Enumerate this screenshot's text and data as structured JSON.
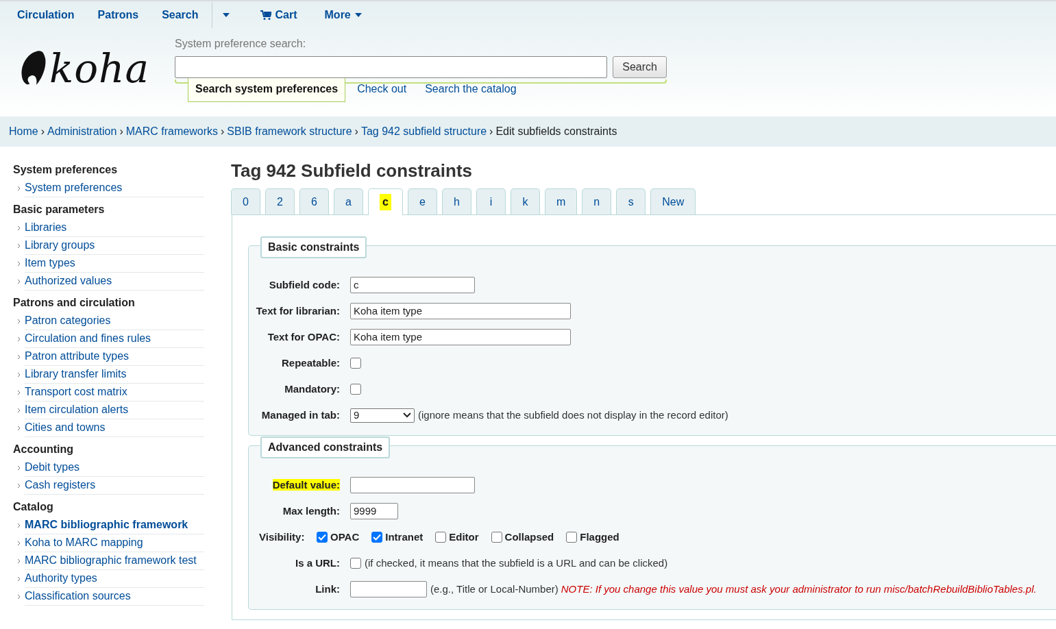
{
  "navbar": {
    "items": [
      {
        "kind": "link",
        "label": "Circulation"
      },
      {
        "kind": "link",
        "label": "Patrons"
      },
      {
        "kind": "link",
        "label": "Search"
      },
      {
        "kind": "caret"
      },
      {
        "kind": "cart",
        "label": "Cart"
      },
      {
        "kind": "menu",
        "label": "More"
      }
    ]
  },
  "logo": {
    "text": "koha"
  },
  "syspref_search": {
    "label": "System preference search:",
    "button": "Search",
    "tabs": [
      {
        "label": "Search system preferences",
        "selected": true
      },
      {
        "label": "Check out",
        "selected": false
      },
      {
        "label": "Search the catalog",
        "selected": false
      }
    ]
  },
  "breadcrumb": {
    "separator": "›",
    "items": [
      {
        "label": "Home",
        "link": true
      },
      {
        "label": "Administration",
        "link": true
      },
      {
        "label": "MARC frameworks",
        "link": true
      },
      {
        "label": "SBIB framework structure",
        "link": true
      },
      {
        "label": "Tag 942 subfield structure",
        "link": true
      },
      {
        "label": "Edit subfields constraints",
        "link": false
      }
    ]
  },
  "sidebar": {
    "sections": [
      {
        "heading": "System preferences",
        "items": [
          {
            "label": "System preferences",
            "selected": false
          }
        ]
      },
      {
        "heading": "Basic parameters",
        "items": [
          {
            "label": "Libraries",
            "selected": false
          },
          {
            "label": "Library groups",
            "selected": false
          },
          {
            "label": "Item types",
            "selected": false
          },
          {
            "label": "Authorized values",
            "selected": false
          }
        ]
      },
      {
        "heading": "Patrons and circulation",
        "items": [
          {
            "label": "Patron categories",
            "selected": false
          },
          {
            "label": "Circulation and fines rules",
            "selected": false
          },
          {
            "label": "Patron attribute types",
            "selected": false
          },
          {
            "label": "Library transfer limits",
            "selected": false
          },
          {
            "label": "Transport cost matrix",
            "selected": false
          },
          {
            "label": "Item circulation alerts",
            "selected": false
          },
          {
            "label": "Cities and towns",
            "selected": false
          }
        ]
      },
      {
        "heading": "Accounting",
        "items": [
          {
            "label": "Debit types",
            "selected": false
          },
          {
            "label": "Cash registers",
            "selected": false
          }
        ]
      },
      {
        "heading": "Catalog",
        "items": [
          {
            "label": "MARC bibliographic framework",
            "selected": true
          },
          {
            "label": "Koha to MARC mapping",
            "selected": false
          },
          {
            "label": "MARC bibliographic framework test",
            "selected": false
          },
          {
            "label": "Authority types",
            "selected": false
          },
          {
            "label": "Classification sources",
            "selected": false
          }
        ]
      }
    ]
  },
  "main": {
    "title": "Tag 942 Subfield constraints",
    "tabs": [
      {
        "label": "0",
        "selected": false,
        "highlighted": false
      },
      {
        "label": "2",
        "selected": false,
        "highlighted": false
      },
      {
        "label": "6",
        "selected": false,
        "highlighted": false
      },
      {
        "label": "a",
        "selected": false,
        "highlighted": false
      },
      {
        "label": "c",
        "selected": true,
        "highlighted": true
      },
      {
        "label": "e",
        "selected": false,
        "highlighted": false
      },
      {
        "label": "h",
        "selected": false,
        "highlighted": false
      },
      {
        "label": "i",
        "selected": false,
        "highlighted": false
      },
      {
        "label": "k",
        "selected": false,
        "highlighted": false
      },
      {
        "label": "m",
        "selected": false,
        "highlighted": false
      },
      {
        "label": "n",
        "selected": false,
        "highlighted": false
      },
      {
        "label": "s",
        "selected": false,
        "highlighted": false
      },
      {
        "label": "New",
        "selected": false,
        "highlighted": false
      }
    ],
    "fieldsets": [
      {
        "legend": "Basic constraints",
        "rows": [
          {
            "kind": "input",
            "label": "Subfield code:",
            "value": "c",
            "highlighted": false
          },
          {
            "kind": "wideinput",
            "label": "Text for librarian:",
            "value": "Koha item type",
            "highlighted": false
          },
          {
            "kind": "wideinput",
            "label": "Text for OPAC:",
            "value": "Koha item type",
            "highlighted": false
          },
          {
            "kind": "checkbox",
            "label": "Repeatable:",
            "checked": false
          },
          {
            "kind": "checkbox",
            "label": "Mandatory:",
            "checked": false
          },
          {
            "kind": "select",
            "label": "Managed in tab:",
            "value": "9",
            "note": "(ignore means that the subfield does not display in the record editor)"
          }
        ]
      },
      {
        "legend": "Advanced constraints",
        "rows": [
          {
            "kind": "input",
            "label": "Default value:",
            "highlighted": true
          },
          {
            "kind": "numinput",
            "label": "Max length:",
            "value": "9999",
            "highlighted": false
          },
          {
            "kind": "checkgroup",
            "label": "Visibility:",
            "options": [
              {
                "label": "OPAC",
                "checked": true
              },
              {
                "label": "Intranet",
                "checked": true
              },
              {
                "label": "Editor",
                "checked": false
              },
              {
                "label": "Collapsed",
                "checked": false
              },
              {
                "label": "Flagged",
                "checked": false
              }
            ]
          },
          {
            "kind": "checkbox",
            "label": "Is a URL:",
            "checked": false,
            "note": "(if checked, it means that the subfield is a URL and can be clicked)"
          },
          {
            "kind": "linkinput",
            "label": "Link:",
            "highlighted": false,
            "note": "(e.g., Title or Local-Number)",
            "warning": "NOTE: If you change this value you must ask your administrator to run misc/batchRebuildBiblioTables.pl."
          }
        ]
      }
    ]
  }
}
